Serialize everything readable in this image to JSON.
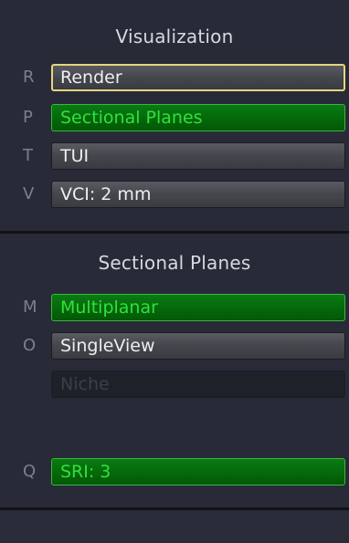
{
  "visualization": {
    "title": "Visualization",
    "items": [
      {
        "key": "R",
        "label": "Render"
      },
      {
        "key": "P",
        "label": "Sectional Planes"
      },
      {
        "key": "T",
        "label": "TUI"
      },
      {
        "key": "V",
        "label": "VCI: 2 mm"
      }
    ]
  },
  "sectional_planes": {
    "title": "Sectional Planes",
    "items": [
      {
        "key": "M",
        "label": "Multiplanar"
      },
      {
        "key": "O",
        "label": "SingleView"
      },
      {
        "key": "",
        "label": "Niche"
      }
    ],
    "sri": {
      "key": "Q",
      "label": "SRI: 3"
    }
  },
  "colors": {
    "background": "#282a38",
    "active_green": "#32e03f",
    "selected_border": "#e3d77c"
  }
}
